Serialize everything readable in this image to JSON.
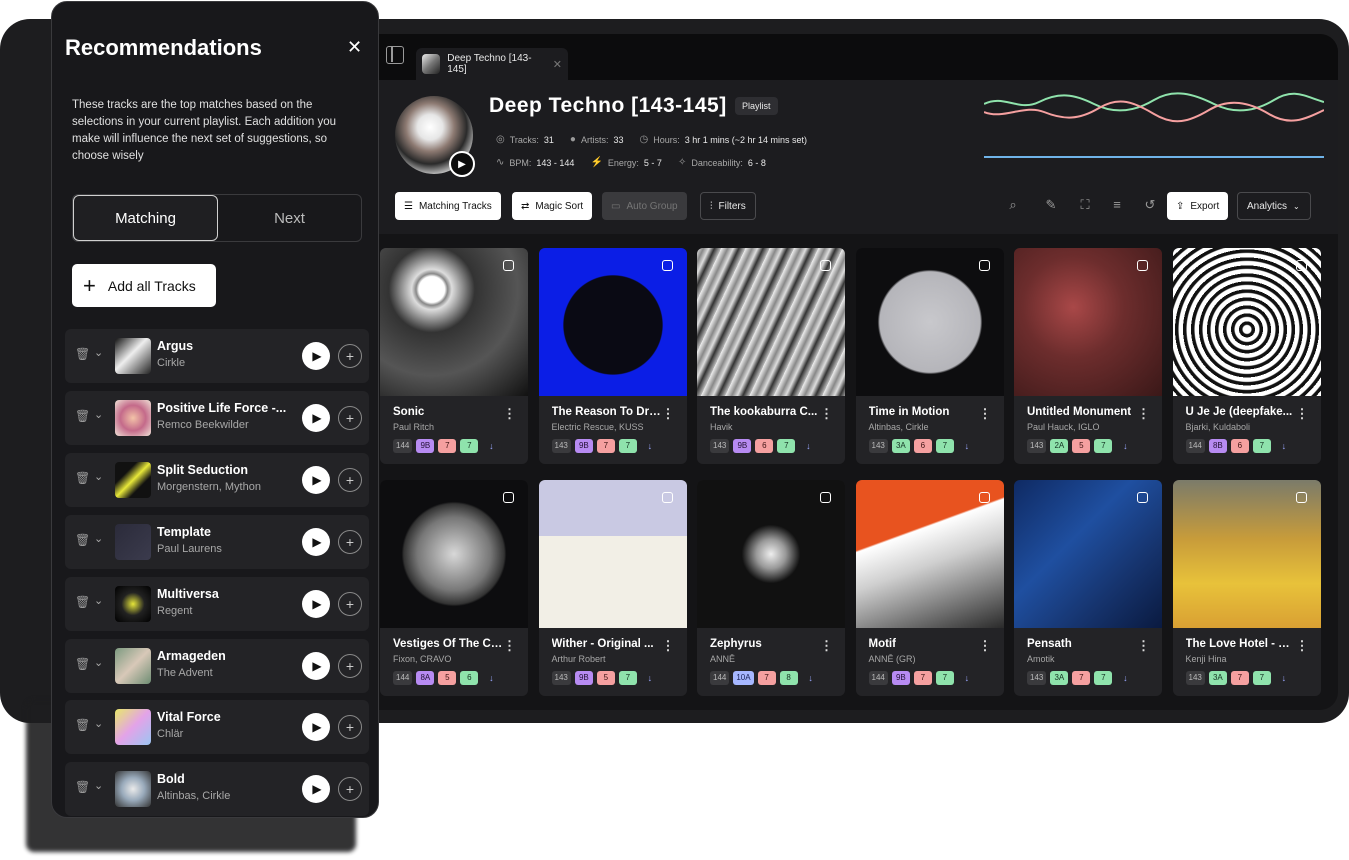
{
  "tabbar": {
    "tab_title": "Deep Techno [143-145]",
    "close_glyph": "✕"
  },
  "playlist": {
    "title": "Deep Techno [143-145]",
    "badge": "Playlist",
    "tracks_label": "Tracks:",
    "tracks": "31",
    "artists_label": "Artists:",
    "artists": "33",
    "hours_label": "Hours:",
    "hours": "3 hr 1 mins (~2 hr 14 mins set)",
    "bpm_label": "BPM:",
    "bpm": "143 - 144",
    "energy_label": "Energy:",
    "energy": "5 - 7",
    "dance_label": "Danceability:",
    "dance": "6 - 8"
  },
  "toolbar": {
    "matching": "Matching Tracks",
    "magic": "Magic Sort",
    "auto": "Auto Group",
    "filters": "Filters",
    "export": "Export",
    "analytics": "Analytics"
  },
  "tracks": [
    {
      "title": "Sonic",
      "artist": "Paul Ritch",
      "bpm": "144",
      "key": "9B",
      "energy": "7",
      "dance": "7",
      "key_color": "purple"
    },
    {
      "title": "The Reason To Dri...",
      "artist": "Electric Rescue, KUSS",
      "bpm": "143",
      "key": "9B",
      "energy": "7",
      "dance": "7",
      "key_color": "purple"
    },
    {
      "title": "The kookaburra C...",
      "artist": "Havik",
      "bpm": "143",
      "key": "9B",
      "energy": "6",
      "dance": "7",
      "key_color": "purple"
    },
    {
      "title": "Time in Motion",
      "artist": "Altinbas, Cirkle",
      "bpm": "143",
      "key": "3A",
      "energy": "6",
      "dance": "7",
      "key_color": "green"
    },
    {
      "title": "Untitled Monument",
      "artist": "Paul Hauck, IGLO",
      "bpm": "143",
      "key": "2A",
      "energy": "5",
      "dance": "7",
      "key_color": "green"
    },
    {
      "title": "Ú Je Je (deepfake...",
      "artist": "Bjarki, Kuldaboli",
      "bpm": "144",
      "key": "8B",
      "energy": "6",
      "dance": "7",
      "key_color": "purple"
    },
    {
      "title": "Vestiges Of The Cl...",
      "artist": "Fixon, CRAVO",
      "bpm": "144",
      "key": "8A",
      "energy": "5",
      "dance": "6",
      "key_color": "purple"
    },
    {
      "title": "Wither - Original ...",
      "artist": "Arthur Robert",
      "bpm": "143",
      "key": "9B",
      "energy": "5",
      "dance": "7",
      "key_color": "purple"
    },
    {
      "title": "Zephyrus",
      "artist": "ANNĒ",
      "bpm": "144",
      "key": "10A",
      "energy": "7",
      "dance": "8",
      "key_color": "blue"
    },
    {
      "title": "Motif",
      "artist": "ANNĒ (GR)",
      "bpm": "144",
      "key": "9B",
      "energy": "7",
      "dance": "7",
      "key_color": "purple"
    },
    {
      "title": "Pensath",
      "artist": "Amotik",
      "bpm": "143",
      "key": "3A",
      "energy": "7",
      "dance": "7",
      "key_color": "green"
    },
    {
      "title": "The Love Hotel - O...",
      "artist": "Kenji Hina",
      "bpm": "143",
      "key": "3A",
      "energy": "7",
      "dance": "7",
      "key_color": "green"
    }
  ],
  "recommendations": {
    "title": "Recommendations",
    "description": "These tracks are the top matches based on the selections in your current playlist. Each addition you make will influence the next set of suggestions, so choose wisely",
    "tab_matching": "Matching",
    "tab_next": "Next",
    "add_all": "Add all Tracks",
    "items": [
      {
        "title": "Argus",
        "artist": "Cirkle"
      },
      {
        "title": "Positive Life Force -...",
        "artist": "Remco Beekwilder"
      },
      {
        "title": "Split Seduction",
        "artist": "Morgenstern, Mython"
      },
      {
        "title": "Template",
        "artist": "Paul Laurens"
      },
      {
        "title": "Multiversa",
        "artist": "Regent"
      },
      {
        "title": "Armageden",
        "artist": "The Advent"
      },
      {
        "title": "Vital Force",
        "artist": "Chlär"
      },
      {
        "title": "Bold",
        "artist": "Altinbas, Cirkle"
      }
    ]
  }
}
